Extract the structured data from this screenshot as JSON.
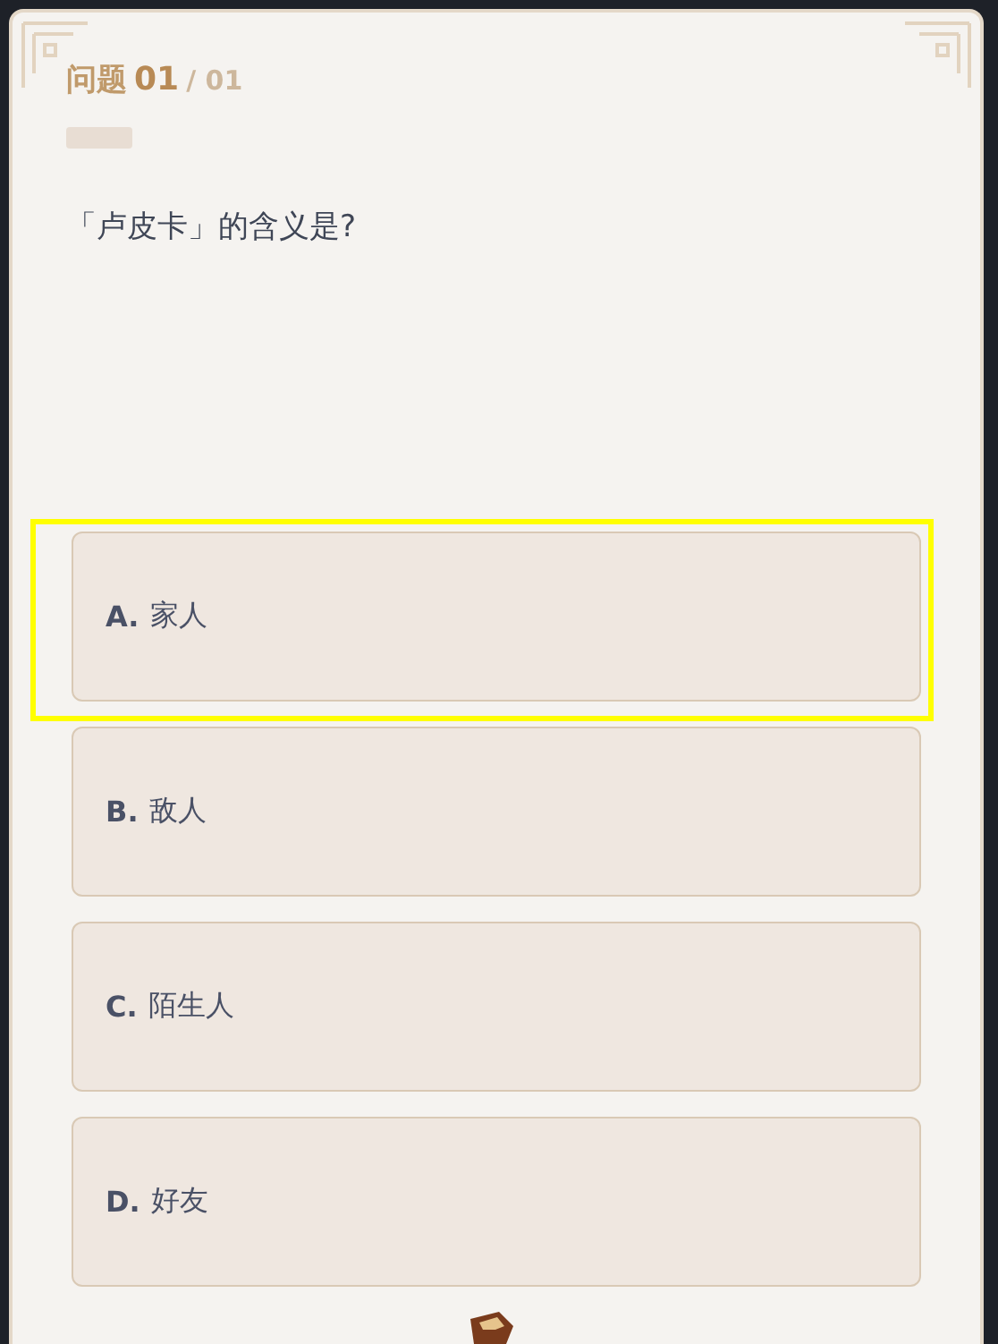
{
  "header": {
    "label": "问题",
    "number": "01",
    "total": "/ 01"
  },
  "question": "「卢皮卡」的含义是?",
  "options": [
    {
      "letter": "A.",
      "text": "家人",
      "selected": true
    },
    {
      "letter": "B.",
      "text": "敌人",
      "selected": false
    },
    {
      "letter": "C.",
      "text": "陌生人",
      "selected": false
    },
    {
      "letter": "D.",
      "text": "好友",
      "selected": false
    }
  ]
}
